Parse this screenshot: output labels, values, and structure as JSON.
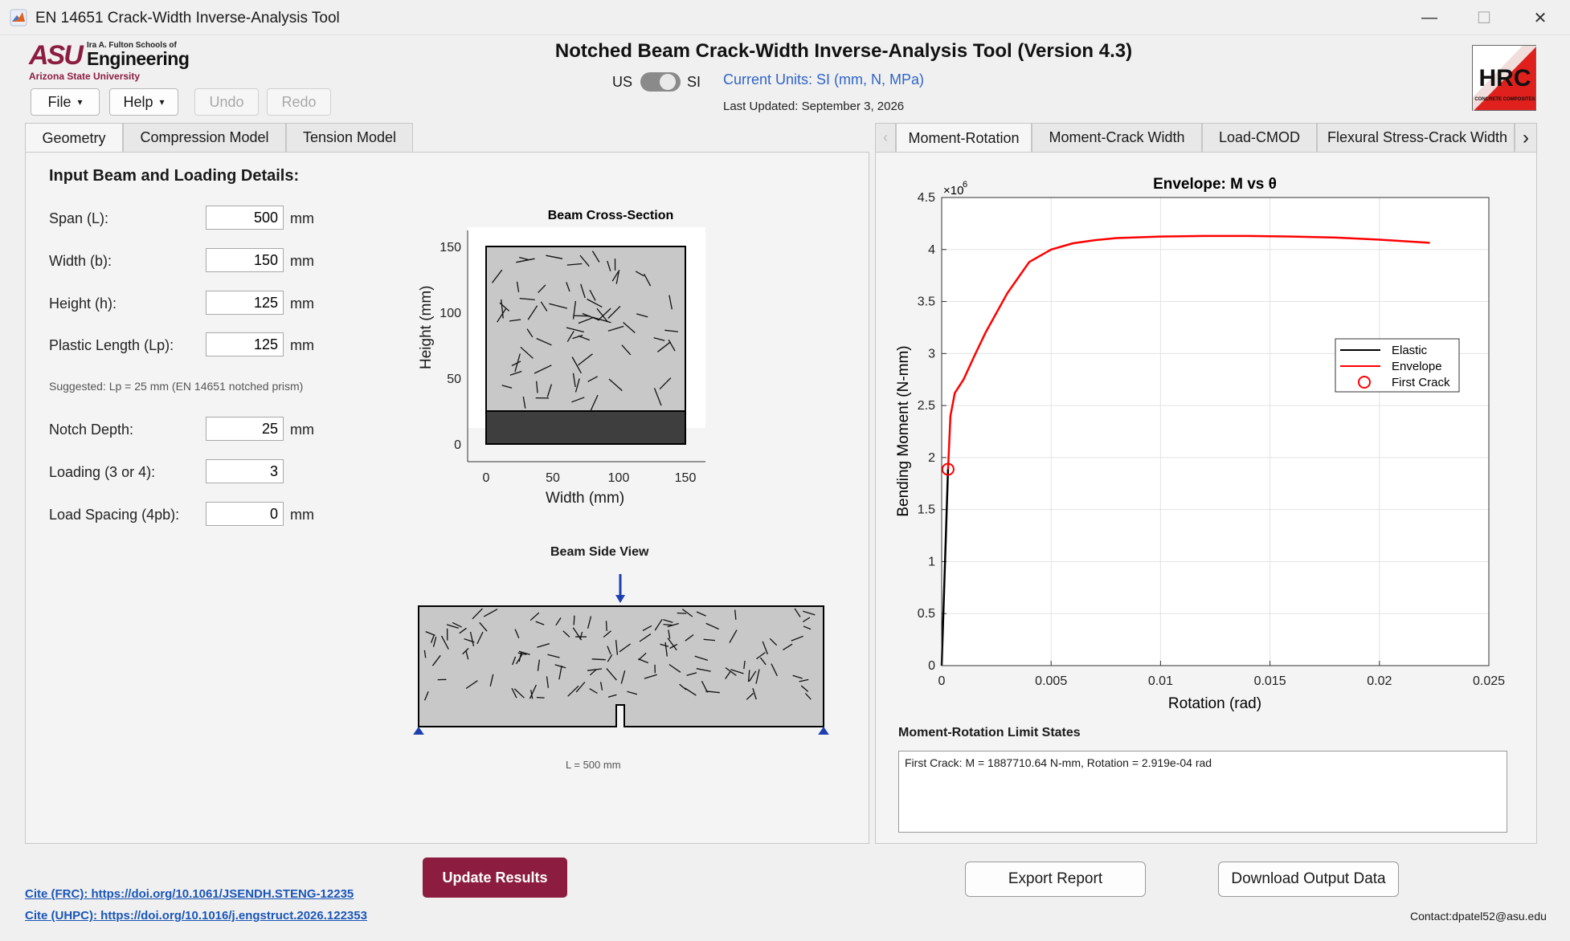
{
  "window": {
    "title": "EN 14651 Crack-Width Inverse-Analysis Tool",
    "minimize_glyph": "—",
    "maximize_glyph": "☐",
    "close_glyph": "✕"
  },
  "logo": {
    "asu_mark": "ASU",
    "school_line": "Ira A. Fulton Schools of",
    "engineering": "Engineering",
    "university": "Arizona State University",
    "hrc_text": "HRC",
    "hrc_sub": "CONCRETE COMPOSITES"
  },
  "toolbar": {
    "file_label": "File",
    "help_label": "Help",
    "undo_label": "Undo",
    "redo_label": "Redo",
    "caret": "▾"
  },
  "header": {
    "title": "Notched Beam Crack-Width Inverse-Analysis Tool (Version 4.3)",
    "us_label": "US",
    "si_label": "SI",
    "current_units": "Current Units: SI (mm, N, MPa)",
    "last_updated": "Last Updated: September 3, 2026"
  },
  "left_tabs": [
    {
      "label": "Geometry",
      "active": true
    },
    {
      "label": "Compression Model",
      "active": false
    },
    {
      "label": "Tension Model",
      "active": false
    }
  ],
  "geometry": {
    "heading": "Input Beam and Loading Details:",
    "fields": [
      {
        "label": "Span (L):",
        "value": "500",
        "unit": "mm"
      },
      {
        "label": "Width (b):",
        "value": "150",
        "unit": "mm"
      },
      {
        "label": "Height (h):",
        "value": "125",
        "unit": "mm"
      },
      {
        "label": "Plastic Length (Lp):",
        "value": "125",
        "unit": "mm"
      },
      {
        "label": "Notch Depth:",
        "value": "25",
        "unit": "mm"
      },
      {
        "label": "Loading (3 or 4):",
        "value": "3",
        "unit": ""
      },
      {
        "label": "Load Spacing (4pb):",
        "value": "0",
        "unit": "mm"
      }
    ],
    "suggestion": "Suggested: Lp = 25 mm (EN 14651 notched prism)"
  },
  "cross_section": {
    "title": "Beam Cross-Section",
    "xlabel": "Width (mm)",
    "ylabel": "Height (mm)",
    "x_ticks": [
      "0",
      "50",
      "100",
      "150"
    ],
    "y_ticks": [
      "0",
      "50",
      "100",
      "150"
    ]
  },
  "side_view": {
    "title": "Beam Side View",
    "span_label": "L = 500 mm"
  },
  "right_tabs": [
    {
      "label": "Moment-Rotation",
      "active": true
    },
    {
      "label": "Moment-Crack Width",
      "active": false
    },
    {
      "label": "Load-CMOD",
      "active": false
    },
    {
      "label": "Flexural Stress-Crack Width",
      "active": false
    }
  ],
  "chart_data": {
    "type": "line",
    "title": "Envelope:  M  vs  θ",
    "xlabel": "Rotation (rad)",
    "ylabel": "Bending Moment (N-mm)",
    "y_multiplier": "×10",
    "y_multiplier_exp": "6",
    "xlim": [
      0,
      0.025
    ],
    "ylim": [
      0,
      4.5
    ],
    "x_ticks": [
      "0",
      "0.005",
      "0.01",
      "0.015",
      "0.02",
      "0.025"
    ],
    "y_ticks": [
      "0",
      "0.5",
      "1",
      "1.5",
      "2",
      "2.5",
      "3",
      "3.5",
      "4",
      "4.5"
    ],
    "grid": true,
    "legend_position": "right",
    "series": [
      {
        "name": "Elastic",
        "color": "#000000",
        "x": [
          0,
          0.00029
        ],
        "y": [
          0,
          1.8877
        ]
      },
      {
        "name": "Envelope",
        "color": "#ff0000",
        "x": [
          0.00029,
          0.0004,
          0.0006,
          0.001,
          0.0015,
          0.002,
          0.003,
          0.004,
          0.005,
          0.006,
          0.007,
          0.008,
          0.01,
          0.012,
          0.014,
          0.016,
          0.018,
          0.02,
          0.0223
        ],
        "y": [
          1.8877,
          2.4,
          2.62,
          2.75,
          2.98,
          3.2,
          3.58,
          3.88,
          4.0,
          4.06,
          4.09,
          4.11,
          4.125,
          4.13,
          4.13,
          4.125,
          4.115,
          4.095,
          4.065
        ]
      },
      {
        "name": "First Crack",
        "color": "#ff0000",
        "marker": "circle",
        "x": [
          0.00029
        ],
        "y": [
          1.8877
        ]
      }
    ]
  },
  "limit_states": {
    "heading": "Moment-Rotation Limit States",
    "text": "First Crack: M = 1887710.64 N-mm, Rotation = 2.919e-04 rad"
  },
  "actions": {
    "update": "Update Results",
    "export": "Export Report",
    "download": "Download Output Data"
  },
  "footer": {
    "cite_frc": "Cite (FRC): https://doi.org/10.1061/JSENDH.STENG-12235",
    "cite_uhpc": "Cite (UHPC): https://doi.org/10.1016/j.engstruct.2026.122353",
    "contact": "Contact:dpatel52@asu.edu"
  },
  "colors": {
    "accent_maroon": "#8c1d40",
    "asu_gold": "#ffc627",
    "link_blue": "#1a56b8",
    "units_blue": "#2f64c8",
    "envelope_red": "#ff0000",
    "support_blue": "#1f3fb0"
  }
}
